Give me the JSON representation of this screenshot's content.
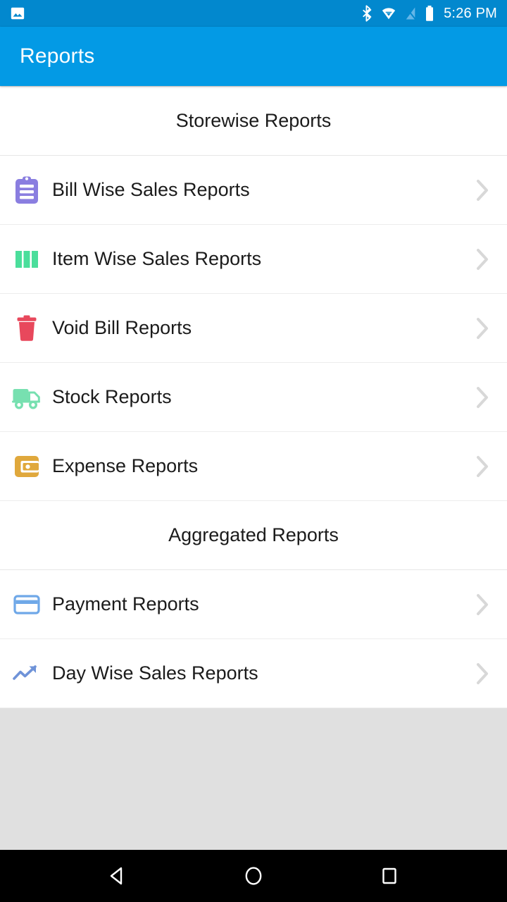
{
  "status_bar": {
    "notification_icon": "image-icon",
    "icons": [
      "bluetooth-icon",
      "wifi-icon",
      "signal-off-icon",
      "battery-icon"
    ],
    "time": "5:26 PM",
    "background_color": "#0288ce"
  },
  "app_bar": {
    "title": "Reports",
    "background_color": "#039ae5",
    "title_color": "#ffffff"
  },
  "sections": [
    {
      "header": "Storewise Reports",
      "items": [
        {
          "label": "Bill Wise Sales Reports",
          "icon": "clipboard-icon",
          "icon_color": "#8a7ee0",
          "chevron": "chevron-right-icon"
        },
        {
          "label": "Item Wise Sales Reports",
          "icon": "bar-chart-icon",
          "icon_color": "#4ade9b",
          "chevron": "chevron-right-icon"
        },
        {
          "label": "Void Bill Reports",
          "icon": "trash-icon",
          "icon_color": "#e8485c",
          "chevron": "chevron-right-icon"
        },
        {
          "label": "Stock Reports",
          "icon": "truck-icon",
          "icon_color": "#77e0b0",
          "chevron": "chevron-right-icon"
        },
        {
          "label": "Expense Reports",
          "icon": "wallet-icon",
          "icon_color": "#e0a83c",
          "chevron": "chevron-right-icon"
        }
      ]
    },
    {
      "header": "Aggregated Reports",
      "items": [
        {
          "label": "Payment Reports",
          "icon": "credit-card-icon",
          "icon_color": "#6fa8e8",
          "chevron": "chevron-right-icon"
        },
        {
          "label": "Day Wise Sales Reports",
          "icon": "trending-up-icon",
          "icon_color": "#6f93d8",
          "chevron": "chevron-right-icon"
        }
      ]
    }
  ],
  "nav_bar": {
    "back": "back-triangle-icon",
    "home": "home-circle-icon",
    "recents": "recents-square-icon",
    "background_color": "#000000"
  },
  "background_color": "#e0e0e0"
}
